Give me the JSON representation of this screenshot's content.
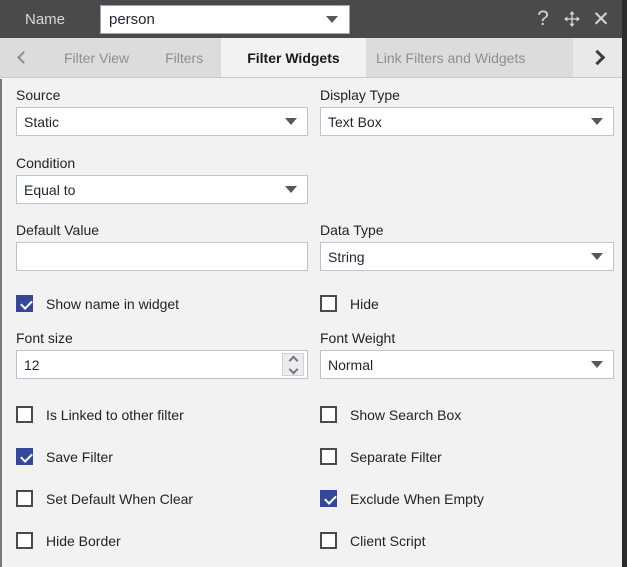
{
  "titlebar": {
    "name_label": "Name",
    "name_value": "person",
    "help_icon": "question-mark-icon",
    "move_icon": "move-arrows-icon",
    "close_icon": "close-icon"
  },
  "tabs": {
    "prev_icon": "chevron-left-icon",
    "next_icon": "chevron-right-icon",
    "items": [
      {
        "label": "Filter View",
        "active": false
      },
      {
        "label": "Filters",
        "active": false
      },
      {
        "label": "Filter Widgets",
        "active": true
      },
      {
        "label": "Link Filters and Widgets",
        "active": false
      }
    ]
  },
  "form": {
    "source": {
      "label": "Source",
      "value": "Static"
    },
    "display_type": {
      "label": "Display Type",
      "value": "Text Box"
    },
    "condition": {
      "label": "Condition",
      "value": "Equal to"
    },
    "default_value": {
      "label": "Default Value",
      "value": "",
      "placeholder": ""
    },
    "data_type": {
      "label": "Data Type",
      "value": "String"
    },
    "font_size": {
      "label": "Font size",
      "value": "12"
    },
    "font_weight": {
      "label": "Font Weight",
      "value": "Normal"
    }
  },
  "checkboxes": {
    "show_name_in_widget": {
      "label": "Show name in widget",
      "checked": true
    },
    "hide": {
      "label": "Hide",
      "checked": false
    },
    "is_linked_to_other_filter": {
      "label": "Is Linked to other filter",
      "checked": false
    },
    "show_search_box": {
      "label": "Show Search Box",
      "checked": false
    },
    "save_filter": {
      "label": "Save Filter",
      "checked": true
    },
    "separate_filter": {
      "label": "Separate Filter",
      "checked": false
    },
    "set_default_when_clear": {
      "label": "Set Default When Clear",
      "checked": false
    },
    "exclude_when_empty": {
      "label": "Exclude When Empty",
      "checked": true
    },
    "hide_border": {
      "label": "Hide Border",
      "checked": false
    },
    "client_script": {
      "label": "Client Script",
      "checked": false
    }
  },
  "colors": {
    "titlebar_bg": "#4a4a4a",
    "tab_inactive_bg": "#dcdcdc",
    "tab_active_bg": "#f2f2f2",
    "body_bg": "#f2f2f2",
    "checkbox_accent": "#33489b",
    "input_border": "#b9c4d4"
  }
}
